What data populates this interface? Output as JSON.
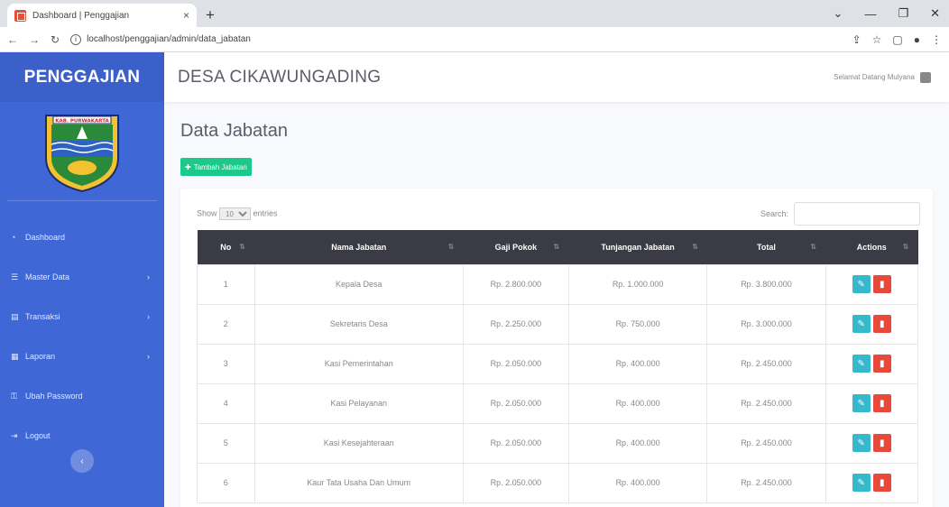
{
  "browser": {
    "tab_title": "Dashboard | Penggajian",
    "url": "localhost/penggajian/admin/data_jabatan"
  },
  "sidebar": {
    "brand": "PENGGAJIAN",
    "logo_text": "KAB. PURWAKARTA",
    "items": [
      {
        "label": "Dashboard",
        "icon": "dashboard-icon",
        "has_arrow": false
      },
      {
        "label": "Master Data",
        "icon": "database-icon",
        "has_arrow": true
      },
      {
        "label": "Transaksi",
        "icon": "money-icon",
        "has_arrow": true
      },
      {
        "label": "Laporan",
        "icon": "report-icon",
        "has_arrow": true
      },
      {
        "label": "Ubah Password",
        "icon": "lock-icon",
        "has_arrow": false
      },
      {
        "label": "Logout",
        "icon": "logout-icon",
        "has_arrow": false
      }
    ]
  },
  "topbar": {
    "village": "DESA CIKAWUNGADING",
    "user": "Selamat Datang Mulyana"
  },
  "page": {
    "title": "Data Jabatan",
    "add_button": "Tambah Jabatan"
  },
  "table_controls": {
    "show_label": "Show",
    "entries_value": "10",
    "entries_label": "entries",
    "search_label": "Search:"
  },
  "table": {
    "headers": [
      "No",
      "Nama Jabatan",
      "Gaji Pokok",
      "Tunjangan Jabatan",
      "Total",
      "Actions"
    ],
    "rows": [
      [
        "1",
        "Kepala Desa",
        "Rp. 2.800.000",
        "Rp. 1.000.000",
        "Rp. 3.800.000"
      ],
      [
        "2",
        "Sekretaris Desa",
        "Rp. 2.250.000",
        "Rp. 750.000",
        "Rp. 3.000.000"
      ],
      [
        "3",
        "Kasi Pemerintahan",
        "Rp. 2.050.000",
        "Rp. 400.000",
        "Rp. 2.450.000"
      ],
      [
        "4",
        "Kasi Pelayanan",
        "Rp. 2.050.000",
        "Rp. 400.000",
        "Rp. 2.450.000"
      ],
      [
        "5",
        "Kasi Kesejahteraan",
        "Rp. 2.050.000",
        "Rp. 400.000",
        "Rp. 2.450.000"
      ],
      [
        "6",
        "Kaur Tata Usaha Dan Umum",
        "Rp. 2.050.000",
        "Rp. 400.000",
        "Rp. 2.450.000"
      ]
    ]
  },
  "colors": {
    "sidebar": "#4067d6",
    "table_header": "#3a3b45",
    "add_button": "#1cc88a",
    "edit_button": "#36b9cc",
    "delete_button": "#e74a3b"
  }
}
